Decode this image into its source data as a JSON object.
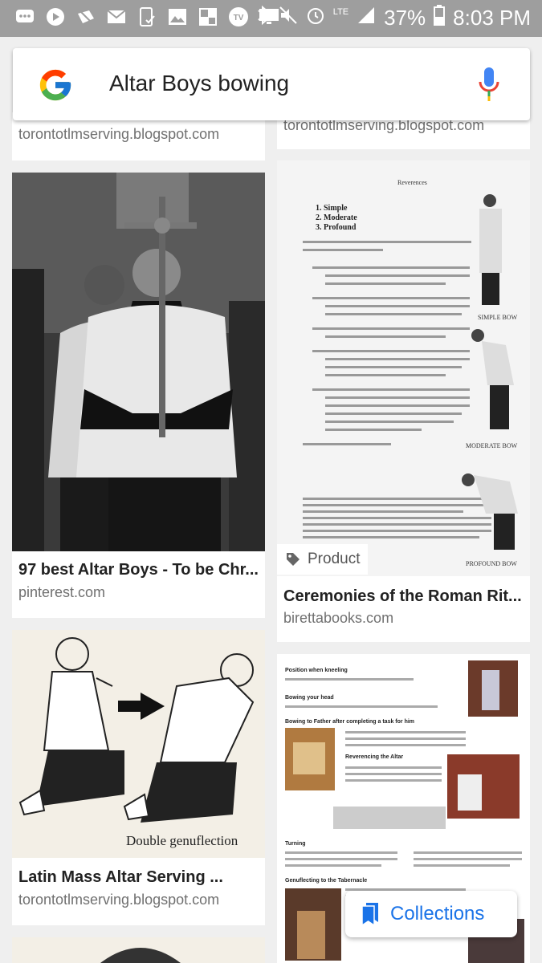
{
  "status_bar": {
    "battery": "37%",
    "time": "8:03 PM",
    "network": "LTE",
    "left_icons": [
      "messages-icon",
      "play-icon",
      "no-signal-icon",
      "mail-icon",
      "phone-check-icon",
      "gallery-icon",
      "news-icon",
      "tv-icon",
      "monitor-icon"
    ],
    "right_icons": [
      "bluetooth-icon",
      "mute-icon",
      "alarm-icon",
      "signal-icon",
      "battery-icon"
    ]
  },
  "search": {
    "query": "Altar Boys bowing"
  },
  "results": [
    {
      "id": "top-left",
      "source": "torontotlmserving.blogspot.com"
    },
    {
      "id": "top-right",
      "source": "torontotlmserving.blogspot.com"
    },
    {
      "id": "altar-boys-photo",
      "title": "97 best Altar Boys - To be Chr...",
      "source": "pinterest.com"
    },
    {
      "id": "reverences-page",
      "title": "Ceremonies of the Roman Rit...",
      "source": "birettabooks.com",
      "chip": "Product"
    },
    {
      "id": "double-genuflection",
      "title": "Latin Mass Altar Serving ...",
      "source": "torontotlmserving.blogspot.com",
      "image_caption": "Double genuflection"
    },
    {
      "id": "kneeling-doc"
    }
  ],
  "reverences_doc": {
    "heading": "Reverences",
    "list": [
      "1. Simple",
      "2. Moderate",
      "3. Profound"
    ],
    "captions": [
      "SIMPLE BOW",
      "MODERATE BOW",
      "PROFOUND BOW"
    ]
  },
  "kneeling_doc": {
    "headings": [
      "Position when kneeling",
      "Bowing your head",
      "Bowing to Father after completing a task for him",
      "Reverencing the Altar",
      "Turning",
      "Genuflecting to the Tabernacle"
    ]
  },
  "collections": {
    "label": "Collections"
  },
  "colors": {
    "accent": "#1a73e8",
    "status_bar": "#9e9e9e",
    "background": "#efefef"
  }
}
